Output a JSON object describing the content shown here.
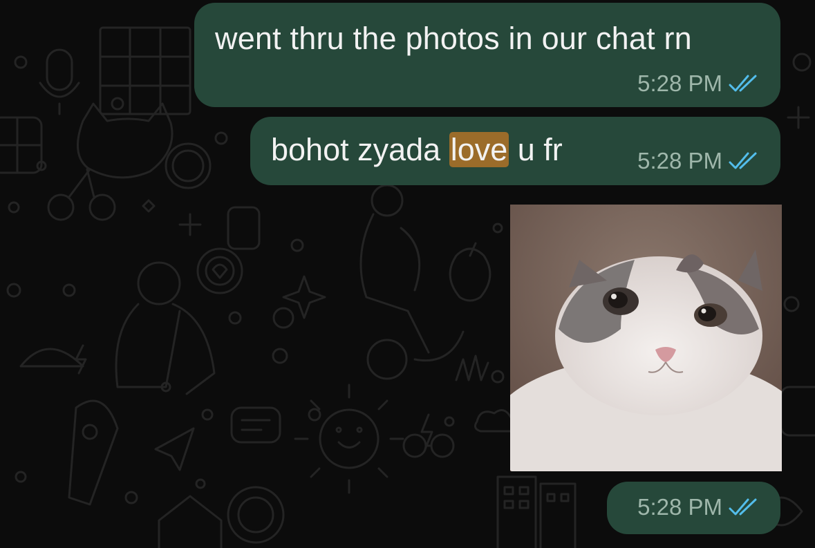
{
  "chat": {
    "messages": [
      {
        "text": "went thru the photos in our chat rn",
        "time": "5:28 PM",
        "status": "read"
      },
      {
        "text_before": "bohot zyada ",
        "highlight": "love",
        "text_after": " u fr",
        "time": "5:28 PM",
        "status": "read"
      },
      {
        "type": "image",
        "image_content": "cat-photo",
        "time": "5:28 PM",
        "status": "read"
      }
    ]
  },
  "colors": {
    "bubble": "#26483a",
    "read_ticks": "#53bdeb",
    "highlight": "#9b6c2a",
    "background": "#0c0c0c"
  },
  "icons": {
    "read_receipt": "double-check-icon"
  }
}
